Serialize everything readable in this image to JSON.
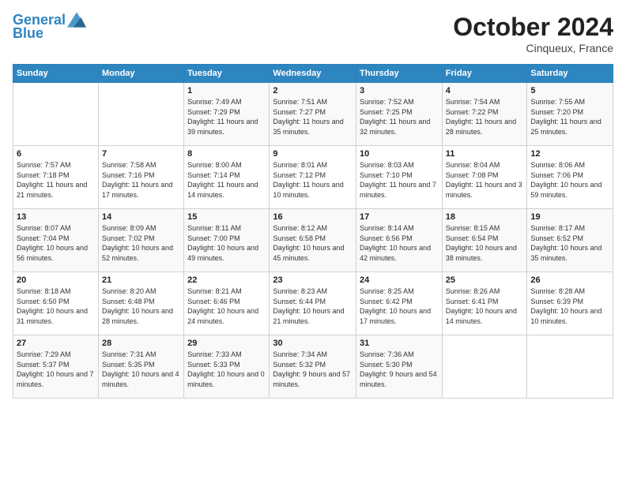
{
  "logo": {
    "line1": "General",
    "line2": "Blue"
  },
  "header": {
    "month": "October 2024",
    "location": "Cinqueux, France"
  },
  "weekdays": [
    "Sunday",
    "Monday",
    "Tuesday",
    "Wednesday",
    "Thursday",
    "Friday",
    "Saturday"
  ],
  "weeks": [
    [
      {
        "day": "",
        "info": ""
      },
      {
        "day": "",
        "info": ""
      },
      {
        "day": "1",
        "info": "Sunrise: 7:49 AM\nSunset: 7:29 PM\nDaylight: 11 hours and 39 minutes."
      },
      {
        "day": "2",
        "info": "Sunrise: 7:51 AM\nSunset: 7:27 PM\nDaylight: 11 hours and 35 minutes."
      },
      {
        "day": "3",
        "info": "Sunrise: 7:52 AM\nSunset: 7:25 PM\nDaylight: 11 hours and 32 minutes."
      },
      {
        "day": "4",
        "info": "Sunrise: 7:54 AM\nSunset: 7:22 PM\nDaylight: 11 hours and 28 minutes."
      },
      {
        "day": "5",
        "info": "Sunrise: 7:55 AM\nSunset: 7:20 PM\nDaylight: 11 hours and 25 minutes."
      }
    ],
    [
      {
        "day": "6",
        "info": "Sunrise: 7:57 AM\nSunset: 7:18 PM\nDaylight: 11 hours and 21 minutes."
      },
      {
        "day": "7",
        "info": "Sunrise: 7:58 AM\nSunset: 7:16 PM\nDaylight: 11 hours and 17 minutes."
      },
      {
        "day": "8",
        "info": "Sunrise: 8:00 AM\nSunset: 7:14 PM\nDaylight: 11 hours and 14 minutes."
      },
      {
        "day": "9",
        "info": "Sunrise: 8:01 AM\nSunset: 7:12 PM\nDaylight: 11 hours and 10 minutes."
      },
      {
        "day": "10",
        "info": "Sunrise: 8:03 AM\nSunset: 7:10 PM\nDaylight: 11 hours and 7 minutes."
      },
      {
        "day": "11",
        "info": "Sunrise: 8:04 AM\nSunset: 7:08 PM\nDaylight: 11 hours and 3 minutes."
      },
      {
        "day": "12",
        "info": "Sunrise: 8:06 AM\nSunset: 7:06 PM\nDaylight: 10 hours and 59 minutes."
      }
    ],
    [
      {
        "day": "13",
        "info": "Sunrise: 8:07 AM\nSunset: 7:04 PM\nDaylight: 10 hours and 56 minutes."
      },
      {
        "day": "14",
        "info": "Sunrise: 8:09 AM\nSunset: 7:02 PM\nDaylight: 10 hours and 52 minutes."
      },
      {
        "day": "15",
        "info": "Sunrise: 8:11 AM\nSunset: 7:00 PM\nDaylight: 10 hours and 49 minutes."
      },
      {
        "day": "16",
        "info": "Sunrise: 8:12 AM\nSunset: 6:58 PM\nDaylight: 10 hours and 45 minutes."
      },
      {
        "day": "17",
        "info": "Sunrise: 8:14 AM\nSunset: 6:56 PM\nDaylight: 10 hours and 42 minutes."
      },
      {
        "day": "18",
        "info": "Sunrise: 8:15 AM\nSunset: 6:54 PM\nDaylight: 10 hours and 38 minutes."
      },
      {
        "day": "19",
        "info": "Sunrise: 8:17 AM\nSunset: 6:52 PM\nDaylight: 10 hours and 35 minutes."
      }
    ],
    [
      {
        "day": "20",
        "info": "Sunrise: 8:18 AM\nSunset: 6:50 PM\nDaylight: 10 hours and 31 minutes."
      },
      {
        "day": "21",
        "info": "Sunrise: 8:20 AM\nSunset: 6:48 PM\nDaylight: 10 hours and 28 minutes."
      },
      {
        "day": "22",
        "info": "Sunrise: 8:21 AM\nSunset: 6:46 PM\nDaylight: 10 hours and 24 minutes."
      },
      {
        "day": "23",
        "info": "Sunrise: 8:23 AM\nSunset: 6:44 PM\nDaylight: 10 hours and 21 minutes."
      },
      {
        "day": "24",
        "info": "Sunrise: 8:25 AM\nSunset: 6:42 PM\nDaylight: 10 hours and 17 minutes."
      },
      {
        "day": "25",
        "info": "Sunrise: 8:26 AM\nSunset: 6:41 PM\nDaylight: 10 hours and 14 minutes."
      },
      {
        "day": "26",
        "info": "Sunrise: 8:28 AM\nSunset: 6:39 PM\nDaylight: 10 hours and 10 minutes."
      }
    ],
    [
      {
        "day": "27",
        "info": "Sunrise: 7:29 AM\nSunset: 5:37 PM\nDaylight: 10 hours and 7 minutes."
      },
      {
        "day": "28",
        "info": "Sunrise: 7:31 AM\nSunset: 5:35 PM\nDaylight: 10 hours and 4 minutes."
      },
      {
        "day": "29",
        "info": "Sunrise: 7:33 AM\nSunset: 5:33 PM\nDaylight: 10 hours and 0 minutes."
      },
      {
        "day": "30",
        "info": "Sunrise: 7:34 AM\nSunset: 5:32 PM\nDaylight: 9 hours and 57 minutes."
      },
      {
        "day": "31",
        "info": "Sunrise: 7:36 AM\nSunset: 5:30 PM\nDaylight: 9 hours and 54 minutes."
      },
      {
        "day": "",
        "info": ""
      },
      {
        "day": "",
        "info": ""
      }
    ]
  ]
}
